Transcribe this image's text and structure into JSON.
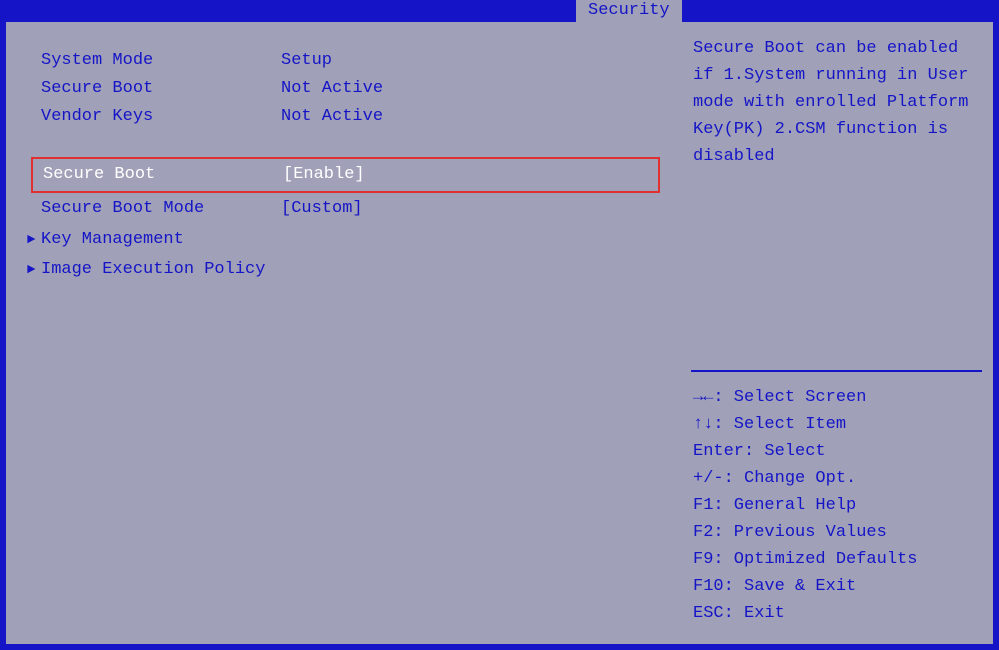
{
  "tab": {
    "label": "Security"
  },
  "info": {
    "system_mode_label": "System Mode",
    "system_mode_value": "Setup",
    "secure_boot_label": "Secure Boot",
    "secure_boot_value": "Not Active",
    "vendor_keys_label": "Vendor Keys",
    "vendor_keys_value": "Not Active"
  },
  "settings": {
    "secure_boot_label": "Secure Boot",
    "secure_boot_value": "[Enable]",
    "secure_boot_mode_label": "Secure Boot Mode",
    "secure_boot_mode_value": "[Custom]",
    "key_management_label": "Key Management",
    "image_exec_policy_label": "Image Execution Policy"
  },
  "help": {
    "text": "Secure Boot can be enabled if 1.System running in User mode with enrolled Platform Key(PK) 2.CSM function is disabled"
  },
  "keymap": {
    "select_screen": "→←: Select Screen",
    "select_item": "↑↓: Select Item",
    "enter": "Enter: Select",
    "change_opt": "+/-: Change Opt.",
    "general_help": "F1: General Help",
    "previous_values": "F2: Previous Values",
    "optimized_defaults": "F9: Optimized Defaults",
    "save_exit": "F10: Save & Exit",
    "esc": "ESC: Exit"
  }
}
